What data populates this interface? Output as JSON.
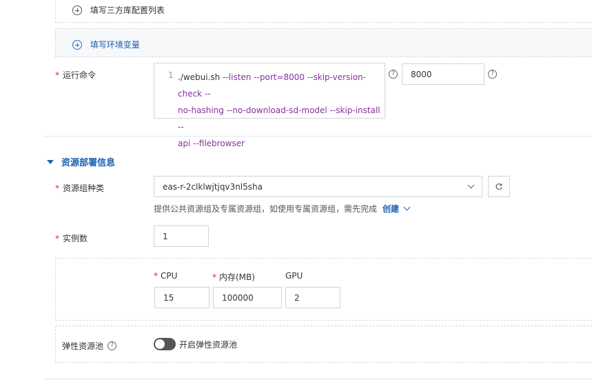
{
  "third_party": {
    "label": "填写三方库配置列表",
    "icon": "circle-plus-icon"
  },
  "env_vars": {
    "label": "填写环境变量",
    "icon": "circle-plus-icon"
  },
  "run_command": {
    "label": "运行命令",
    "required_mark": "*",
    "line_number": "1",
    "code_lines": [
      "./webui.sh --listen  --port=8000 --skip-version-check --",
      "no-hashing --no-download-sd-model --skip-install --",
      "api --filebrowser"
    ],
    "port_value": "8000",
    "help_icon": "?"
  },
  "resource_section": {
    "title": "资源部署信息",
    "resource_group": {
      "label": "资源组种类",
      "required_mark": "*",
      "selected": "eas-r-2clklwjtjqv3nl5sha",
      "hint": "提供公共资源组及专属资源组，如使用专属资源组，需先完成",
      "create_label": "创建"
    },
    "instances": {
      "label": "实例数",
      "required_mark": "*",
      "value": "1"
    },
    "cpu": {
      "label": "CPU",
      "required_mark": "*",
      "value": "15"
    },
    "memory": {
      "label": "内存(MB)",
      "required_mark": "*",
      "value": "100000"
    },
    "gpu": {
      "label": "GPU",
      "value": "2"
    },
    "elastic_pool": {
      "label": "弹性资源池",
      "toggle_label": "开启弹性资源池",
      "enabled": false
    }
  },
  "colors": {
    "accent_blue": "#1a5fb4",
    "required_red": "#d8262c",
    "code_flag_purple": "#8a2f9e"
  }
}
